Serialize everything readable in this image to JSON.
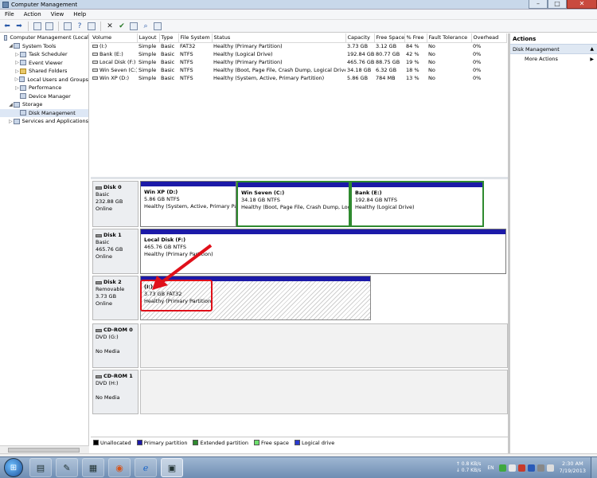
{
  "window": {
    "title": "Computer Management"
  },
  "window_buttons": {
    "minimize": "–",
    "maximize": "□",
    "close": "✕"
  },
  "menu": [
    "File",
    "Action",
    "View",
    "Help"
  ],
  "toolbar_icons": [
    "back-arrow-icon",
    "forward-arrow-icon",
    "up-folder-icon",
    "show-hide-tree-icon",
    "properties-icon",
    "help-icon",
    "grid-icon",
    "delete-icon",
    "checkmark-icon",
    "folder-icon",
    "search-icon",
    "pane-icon"
  ],
  "tree": [
    {
      "label": "Computer Management (Local",
      "level": 0,
      "expander": "",
      "icon": "computer-icon"
    },
    {
      "label": "System Tools",
      "level": 1,
      "expander": "◢",
      "icon": "tools-icon"
    },
    {
      "label": "Task Scheduler",
      "level": 2,
      "expander": "▷",
      "icon": "clock-icon"
    },
    {
      "label": "Event Viewer",
      "level": 2,
      "expander": "▷",
      "icon": "event-viewer-icon"
    },
    {
      "label": "Shared Folders",
      "level": 2,
      "expander": "▷",
      "icon": "folder-icon"
    },
    {
      "label": "Local Users and Groups",
      "level": 2,
      "expander": "▷",
      "icon": "users-icon"
    },
    {
      "label": "Performance",
      "level": 2,
      "expander": "▷",
      "icon": "performance-icon"
    },
    {
      "label": "Device Manager",
      "level": 2,
      "expander": "",
      "icon": "device-manager-icon"
    },
    {
      "label": "Storage",
      "level": 1,
      "expander": "◢",
      "icon": "storage-icon"
    },
    {
      "label": "Disk Management",
      "level": 2,
      "expander": "",
      "icon": "disk-icon",
      "selected": true
    },
    {
      "label": "Services and Applications",
      "level": 1,
      "expander": "▷",
      "icon": "services-icon"
    }
  ],
  "volume_table": {
    "columns": [
      "Volume",
      "Layout",
      "Type",
      "File System",
      "Status",
      "Capacity",
      "Free Space",
      "% Free",
      "Fault Tolerance",
      "Overhead"
    ],
    "rows": [
      [
        "(I:)",
        "Simple",
        "Basic",
        "FAT32",
        "Healthy (Primary Partition)",
        "3.73 GB",
        "3.12 GB",
        "84 %",
        "No",
        "0%"
      ],
      [
        "Bank (E:)",
        "Simple",
        "Basic",
        "NTFS",
        "Healthy (Logical Drive)",
        "192.84 GB",
        "80.77 GB",
        "42 %",
        "No",
        "0%"
      ],
      [
        "Local Disk (F:)",
        "Simple",
        "Basic",
        "NTFS",
        "Healthy (Primary Partition)",
        "465.76 GB",
        "88.75 GB",
        "19 %",
        "No",
        "0%"
      ],
      [
        "Win Seven (C:)",
        "Simple",
        "Basic",
        "NTFS",
        "Healthy (Boot, Page File, Crash Dump, Logical Drive)",
        "34.18 GB",
        "6.32 GB",
        "18 %",
        "No",
        "0%"
      ],
      [
        "Win XP (D:)",
        "Simple",
        "Basic",
        "NTFS",
        "Healthy (System, Active, Primary Partition)",
        "5.86 GB",
        "784 MB",
        "13 %",
        "No",
        "0%"
      ]
    ]
  },
  "disks": [
    {
      "name": "Disk 0",
      "type": "Basic",
      "size": "232.88 GB",
      "status": "Online",
      "partitions": [
        {
          "name": "Win XP  (D:)",
          "size": "5.86 GB NTFS",
          "status": "Healthy (System, Active, Primary Pa",
          "style": "primary"
        },
        {
          "name": "Win Seven  (C:)",
          "size": "34.18 GB NTFS",
          "status": "Healthy (Boot, Page File, Crash Dump, Logi",
          "style": "logical"
        },
        {
          "name": "Bank  (E:)",
          "size": "192.84 GB NTFS",
          "status": "Healthy (Logical Drive)",
          "style": "logical"
        }
      ]
    },
    {
      "name": "Disk 1",
      "type": "Basic",
      "size": "465.76 GB",
      "status": "Online",
      "partitions": [
        {
          "name": "Local Disk  (F:)",
          "size": "465.76 GB NTFS",
          "status": "Healthy (Primary Partition)",
          "style": "primary"
        }
      ]
    },
    {
      "name": "Disk 2",
      "type": "Removable",
      "size": "3.73 GB",
      "status": "Online",
      "partitions": [
        {
          "name": "(I:)",
          "size": "3.73 GB FAT32",
          "status": "Healthy (Primary Partition)",
          "style": "primary-selected"
        }
      ]
    },
    {
      "name": "CD-ROM 0",
      "type": "DVD (G:)",
      "size": "",
      "status": "No Media",
      "partitions": []
    },
    {
      "name": "CD-ROM 1",
      "type": "DVD (H:)",
      "size": "",
      "status": "No Media",
      "partitions": []
    }
  ],
  "legend": [
    {
      "label": "Unallocated",
      "color": "#000000"
    },
    {
      "label": "Primary partition",
      "color": "#1c1aa8"
    },
    {
      "label": "Extended partition",
      "color": "#2f8a2f"
    },
    {
      "label": "Free space",
      "color": "#6ee06e"
    },
    {
      "label": "Logical drive",
      "color": "#2a3ad0"
    }
  ],
  "actions": {
    "header": "Actions",
    "section": "Disk Management",
    "section_arrow": "▲",
    "more": "More Actions",
    "more_arrow": "▶"
  },
  "taskbar": {
    "apps": [
      "file-explorer-icon",
      "notepad-icon",
      "calculator-icon",
      "firefox-icon",
      "internet-explorer-icon",
      "computer-management-icon"
    ],
    "active_app": 5,
    "net_up": "0.8 KB/s",
    "net_down": "0.7 KB/s",
    "lang": "EN",
    "time": "2:30 AM",
    "date": "7/19/2013"
  },
  "annotation": {
    "color": "#e0101a"
  }
}
